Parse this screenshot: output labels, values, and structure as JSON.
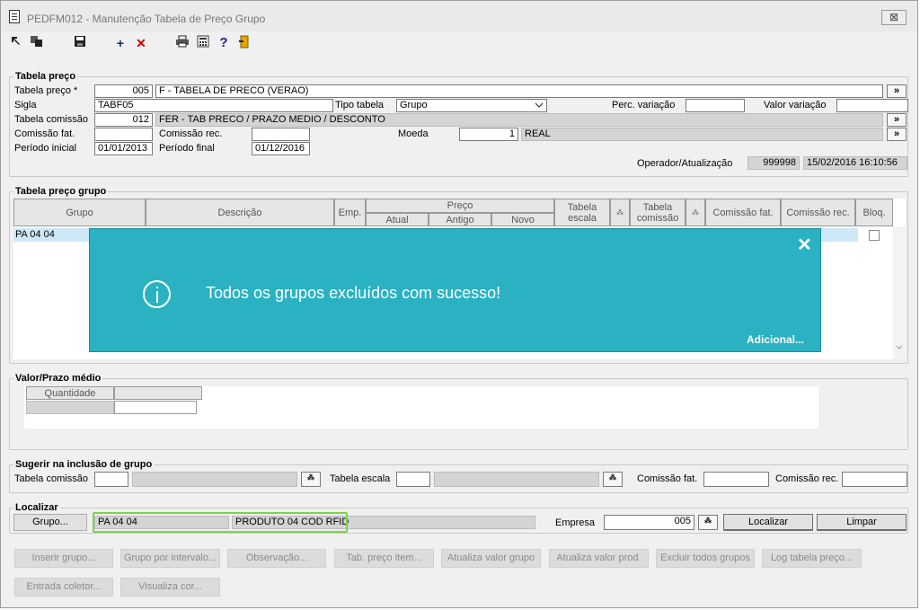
{
  "window": {
    "title": "PEDFM012 - Manutenção Tabela de Preço Grupo",
    "close_label": "⊠"
  },
  "toolbar": {
    "icons": [
      "nav-first-icon",
      "nav-copy-icon",
      "save-icon",
      "add-icon",
      "delete-icon",
      "print-icon",
      "calculator-icon",
      "help-icon",
      "exit-icon"
    ]
  },
  "tabela_preco": {
    "legend": "Tabela preço",
    "tabela_label": "Tabela preço *",
    "tabela_code": "005",
    "tabela_desc": "F - TABELA DE PRECO (VERAO)",
    "sigla_label": "Sigla",
    "sigla": "TABF05",
    "tipo_label": "Tipo tabela",
    "tipo_value": "Grupo",
    "perc_label": "Perc. variação",
    "perc_value": "",
    "valor_var_label": "Valor variação",
    "valor_var_value": "",
    "comissao_label": "Tabela comissão",
    "comissao_code": "012",
    "comissao_desc": "FER - TAB PRECO / PRAZO MEDIO / DESCONTO",
    "comfat_label": "Comissão fat.",
    "comfat_value": "",
    "comrec_label": "Comissão rec.",
    "comrec_value": "",
    "moeda_label": "Moeda",
    "moeda_code": "1",
    "moeda_desc": "REAL",
    "pinicial_label": "Período inicial",
    "pinicial": "01/01/2013",
    "pfinal_label": "Período final",
    "pfinal": "01/12/2016",
    "operador_label": "Operador/Atualização",
    "operador": "999998",
    "atualizacao": "15/02/2016 16:10:56",
    "lookup": "»"
  },
  "grupo_grid": {
    "legend": "Tabela preço grupo",
    "headers": {
      "grupo": "Grupo",
      "descricao": "Descrição",
      "emp": "Emp.",
      "preco": "Preço",
      "atual": "Atual",
      "antigo": "Antigo",
      "novo": "Novo",
      "tab_escala": "Tabela escala",
      "tab_comissao": "Tabela comissão",
      "comfat": "Comissão fat.",
      "comrec": "Comissão rec.",
      "bloq": "Bloq.",
      "sort_glyph": "⁂"
    },
    "rows": [
      {
        "grupo": "PA 04 04"
      }
    ]
  },
  "toast": {
    "message": "Todos os grupos excluídos com sucesso!",
    "more": "Adicional...",
    "close": "✕"
  },
  "valor_prazo": {
    "legend": "Valor/Prazo médio",
    "col_quantidade": "Quantidade"
  },
  "sugerir": {
    "legend": "Sugerir na inclusão de grupo",
    "tab_comissao_label": "Tabela comissão",
    "tab_escala_label": "Tabela escala",
    "comfat_label": "Comissão fat.",
    "comrec_label": "Comissão rec."
  },
  "localizar": {
    "legend": "Localizar",
    "grupo_btn": "Grupo...",
    "grupo_code": "PA 04 04",
    "grupo_desc": "PRODUTO 04 COD RFID",
    "empresa_label": "Empresa",
    "empresa_value": "005",
    "localizar_btn": "Localizar",
    "limpar_btn": "Limpar"
  },
  "actions": [
    "Inserir grupo...",
    "Grupo por intervalo...",
    "Observação...",
    "Tab. preço item...",
    "Atualiza valor grupo",
    "Atualiza valor prod.",
    "Excluir todos grupos",
    "Log tabela preço...",
    "Entrada coletor...",
    "Visualiza cor..."
  ]
}
